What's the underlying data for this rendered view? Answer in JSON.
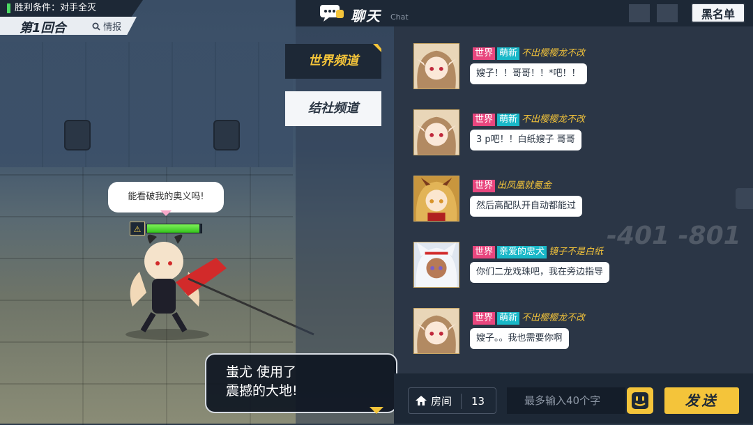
{
  "battle": {
    "victory_label": "胜利条件：对手全灭",
    "round_label": "第1回合",
    "info_label": "情报",
    "speech_text": "能看破我的奥义吗!",
    "hp_icon": "warning-shield-icon",
    "hp_fraction": 0.96,
    "skill_line1": "蚩尤 使用了",
    "skill_line2": "震撼的大地!",
    "background_numbers": "-401 -801"
  },
  "chat": {
    "title": "聊天",
    "subtitle": "Chat",
    "blacklist_label": "黑名单",
    "tabs": [
      {
        "label": "世界频道",
        "active": true
      },
      {
        "label": "结社频道",
        "active": false
      }
    ],
    "messages": [
      {
        "badges": [
          "世界",
          "萌新"
        ],
        "sender": "不出樱樱龙不改",
        "text": "嫂子！！哥哥！！*吧！！",
        "avatar": "brown-hair-elf-girl-avatar"
      },
      {
        "badges": [
          "世界",
          "萌新"
        ],
        "sender": "不出樱樱龙不改",
        "text": "3 p吧！！白纸嫂子 哥哥",
        "avatar": "brown-hair-elf-girl-avatar"
      },
      {
        "badges": [
          "世界"
        ],
        "sender": "出凤凰就氪金",
        "text": "然后高配队开自动都能过",
        "avatar": "blonde-horned-girl-avatar"
      },
      {
        "badges": [
          "世界",
          "亲爱的忠犬"
        ],
        "sender": "镜子不是白纸",
        "text": "你们二龙戏珠吧，我在旁边指导",
        "avatar": "white-hair-cat-girl-avatar"
      },
      {
        "badges": [
          "世界",
          "萌新"
        ],
        "sender": "不出樱樱龙不改",
        "text": "嫂子。。我也需要你啊",
        "avatar": "brown-hair-elf-girl-avatar"
      }
    ],
    "room_label": "房间",
    "room_number": "13",
    "input_placeholder": "最多输入40个字",
    "send_label": "发送"
  },
  "colors": {
    "accent_yellow": "#f4c43a",
    "badge_world": "#e8467e",
    "badge_cyan": "#19b8c8",
    "panel_dark": "#1d2836",
    "hp_green": "#4cd964"
  }
}
